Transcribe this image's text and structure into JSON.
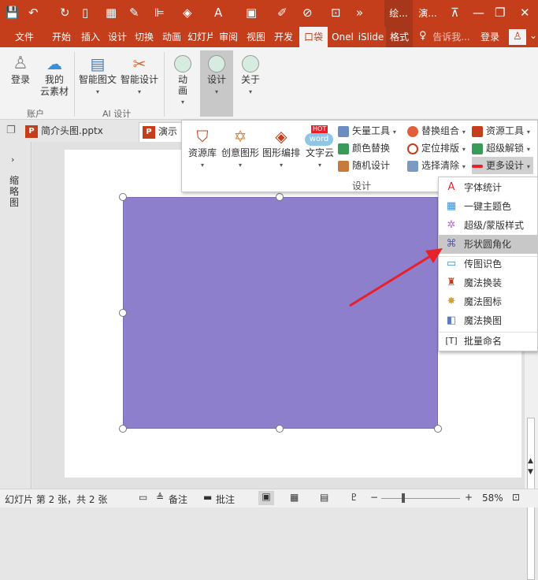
{
  "qat": {
    "app_tabs": [
      "绘...",
      "演..."
    ]
  },
  "tabs": [
    "文件",
    "开始",
    "插入",
    "设计",
    "切换",
    "动画",
    "幻灯片",
    "审阅",
    "视图",
    "开发",
    "口袋",
    "Onel",
    "iSlide",
    "格式"
  ],
  "tell_me": "告诉我...",
  "login": "登录",
  "ribbon": {
    "account": {
      "login": "登录",
      "cloud1": "我的",
      "cloud2": "云素材",
      "group": "账户"
    },
    "ai": {
      "smart_text": "智能图文",
      "smart_design": "智能设计",
      "group": "AI 设计"
    },
    "anim": "动画",
    "design": "设计",
    "about": "关于"
  },
  "doc_tabs": {
    "tab1": "简介头图.pptx",
    "tab2": "演示"
  },
  "panel": {
    "items": [
      "资源库",
      "创意图形",
      "图形编排",
      "文字云"
    ],
    "hot_badge": "HOT",
    "word_logo": "word",
    "col1": [
      "矢量工具",
      "颜色替换",
      "随机设计"
    ],
    "col2": [
      "替换组合",
      "定位排版",
      "选择清除"
    ],
    "col3": [
      "资源工具",
      "超级解锁",
      "更多设计"
    ],
    "group": "设计"
  },
  "menu": [
    "字体统计",
    "一键主题色",
    "超级/蒙版样式",
    "形状圆角化",
    "传图识色",
    "魔法换装",
    "魔法图标",
    "魔法换图",
    "批量命名"
  ],
  "left_pane_label": "缩略图",
  "status": {
    "slide": "幻灯片 第 2 张，共 2 张",
    "notes": "备注",
    "comments": "批注",
    "zoom": "58%"
  },
  "colors": {
    "accent": "#c43e1c",
    "shape": "#8e7fcd",
    "arrow": "#e8202a"
  }
}
